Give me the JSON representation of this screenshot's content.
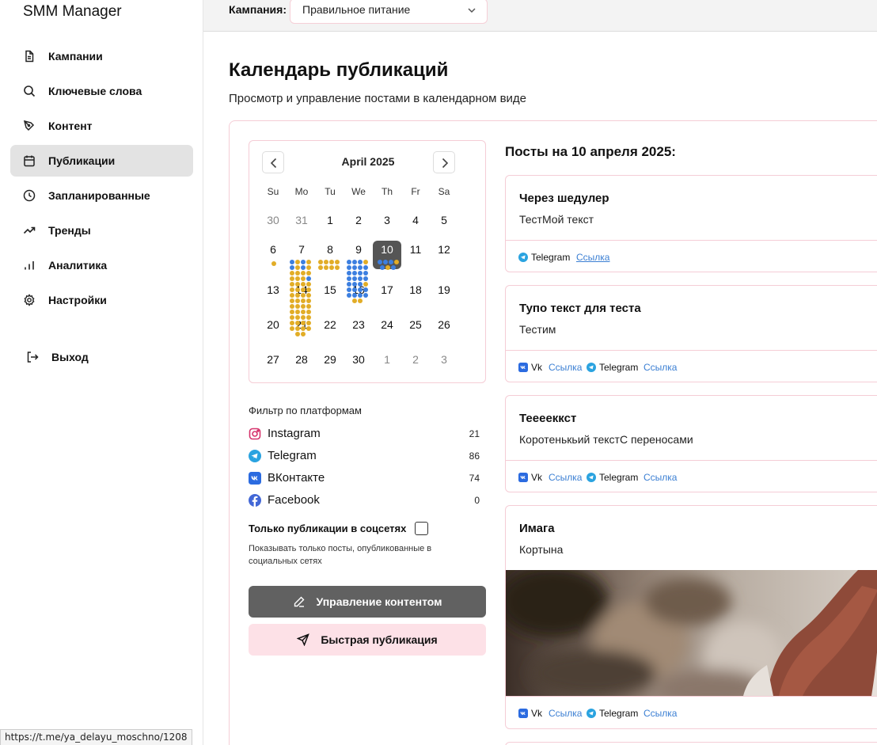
{
  "app": {
    "brand": "SMM Manager"
  },
  "sidebar": {
    "items": [
      {
        "label": "Кампании",
        "icon": "document-icon"
      },
      {
        "label": "Ключевые слова",
        "icon": "search-icon"
      },
      {
        "label": "Контент",
        "icon": "pen-icon"
      },
      {
        "label": "Публикации",
        "icon": "calendar-icon",
        "active": true
      },
      {
        "label": "Запланированные",
        "icon": "clock-icon"
      },
      {
        "label": "Тренды",
        "icon": "trending-icon"
      },
      {
        "label": "Аналитика",
        "icon": "bar-chart-icon"
      },
      {
        "label": "Настройки",
        "icon": "gear-icon"
      }
    ],
    "logout": "Выход"
  },
  "topbar": {
    "campaign_label": "Кампания:",
    "campaign_value": "Правильное питание"
  },
  "header": {
    "title": "Календарь публикаций",
    "subtitle": "Просмотр и управление постами в календарном виде"
  },
  "calendar": {
    "month": "April 2025",
    "weekdays": [
      "Su",
      "Mo",
      "Tu",
      "We",
      "Th",
      "Fr",
      "Sa"
    ],
    "weeks": [
      [
        "30",
        "31",
        "1",
        "2",
        "3",
        "4",
        "5"
      ],
      [
        "6",
        "7",
        "8",
        "9",
        "10",
        "11",
        "12"
      ],
      [
        "13",
        "14",
        "15",
        "16",
        "17",
        "18",
        "19"
      ],
      [
        "20",
        "21",
        "22",
        "23",
        "24",
        "25",
        "26"
      ],
      [
        "27",
        "28",
        "29",
        "30",
        "1",
        "2",
        "3"
      ]
    ],
    "selected_day": "10",
    "colors": {
      "telegram": "#3c7fe0",
      "vk": "#e2ad27"
    }
  },
  "filter": {
    "title": "Фильтр по платформам",
    "platforms": [
      {
        "name": "Instagram",
        "count": "21",
        "icon": "instagram-icon",
        "color": "#d6336c"
      },
      {
        "name": "Telegram",
        "count": "86",
        "icon": "telegram-icon",
        "color": "#2aa3e0"
      },
      {
        "name": "ВКонтакте",
        "count": "74",
        "icon": "vk-icon",
        "color": "#2b6be0"
      },
      {
        "name": "Facebook",
        "count": "0",
        "icon": "facebook-icon",
        "color": "#4267d6"
      }
    ],
    "only_published_label": "Только публикации в соцсетях",
    "only_published_desc": "Показывать только посты, опубликованные в социальных сетях"
  },
  "actions": {
    "manage": "Управление контентом",
    "quick_publish": "Быстрая публикация"
  },
  "posts": {
    "title": "Посты на 10 апреля 2025:",
    "items": [
      {
        "title": "Через шедулер",
        "text": "ТестМой текст",
        "platforms": [
          {
            "name": "Telegram",
            "link": "Ссылка"
          }
        ]
      },
      {
        "title": "Тупо текст для теста",
        "text": "Тестим",
        "platforms": [
          {
            "name": "Vk",
            "link": "Ссылка"
          },
          {
            "name": "Telegram",
            "link": "Ссылка"
          }
        ]
      },
      {
        "title": "Тееееккст",
        "text": "Коротенькьий текстС переносами",
        "platforms": [
          {
            "name": "Vk",
            "link": "Ссылка"
          },
          {
            "name": "Telegram",
            "link": "Ссылка"
          }
        ]
      },
      {
        "title": "Имага",
        "text": "Кортына",
        "platforms": [
          {
            "name": "Vk",
            "link": "Ссылка"
          },
          {
            "name": "Telegram",
            "link": "Ссылка"
          }
        ]
      }
    ]
  },
  "status_url": "https://t.me/ya_delayu_moschno/1208"
}
